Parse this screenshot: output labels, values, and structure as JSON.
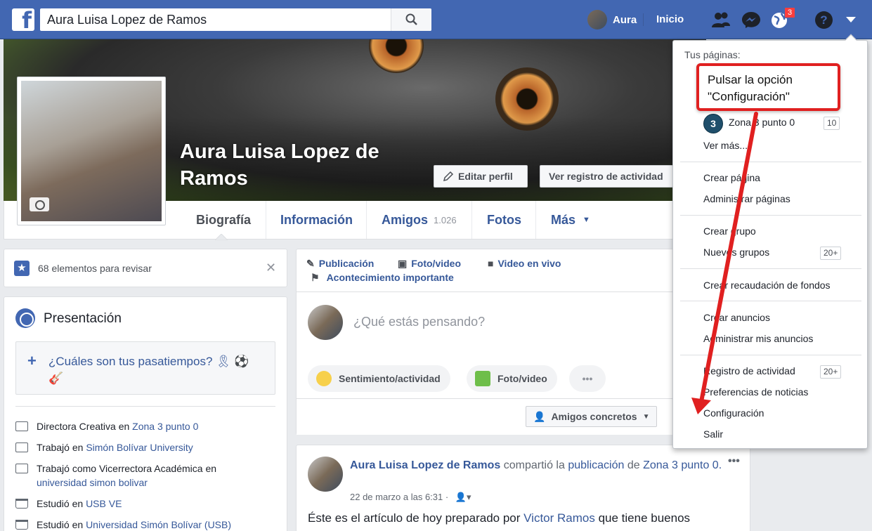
{
  "topbar": {
    "logo": "f",
    "search_value": "Aura Luisa Lopez de Ramos",
    "user_name": "Aura",
    "home": "Inicio",
    "notifications_badge": "3",
    "help": "?",
    "brand_color": "#4267b2"
  },
  "profile": {
    "name": "Aura Luisa Lopez de Ramos",
    "edit_profile": "Editar perfil",
    "activity_log": "Ver registro de actividad"
  },
  "tabs": {
    "biography": "Biografía",
    "info": "Información",
    "friends": "Amigos",
    "friends_count": "1.026",
    "photos": "Fotos",
    "more": "Más"
  },
  "review": {
    "text": "68 elementos para revisar"
  },
  "presentation": {
    "title": "Presentación",
    "hobbies_prompt": "¿Cuáles son tus pasatiempos? 🎗 ⚽ 🎸",
    "items": [
      {
        "prefix": "Directora Creativa en ",
        "link": "Zona 3 punto 0"
      },
      {
        "prefix": "Trabajó en ",
        "link": "Simón Bolívar University"
      },
      {
        "prefix": "Trabajó como Vicerrectora Académica en ",
        "link": "universidad simon bolivar"
      },
      {
        "prefix": "Estudió en ",
        "link": "USB VE"
      },
      {
        "prefix": "Estudió en ",
        "link": "Universidad Simón Bolívar (USB)"
      }
    ]
  },
  "composer": {
    "post": "Publicación",
    "photo_video": "Foto/video",
    "live": "Video en vivo",
    "life_event": "Acontecimiento importante",
    "placeholder": "¿Qué estás pensando?",
    "feeling": "Sentimiento/actividad",
    "photo_video_pill": "Foto/video",
    "more": "•••",
    "audience": "Amigos concretos"
  },
  "post": {
    "author": "Aura Luisa Lopez de Ramos",
    "shared": " compartió la ",
    "publication": "publicación",
    "of": " de ",
    "page": "Zona 3 punto 0",
    "period": ".",
    "date": "22 de marzo a las 6:31 ·",
    "text_prefix": "Éste es el artículo de hoy preparado por ",
    "text_link": "Victor Ramos",
    "text_suffix": " que tiene buenos",
    "menu": "•••"
  },
  "dropdown": {
    "your_pages": "Tus páginas:",
    "page_name": "Zona 3 punto 0",
    "page_avatar": "3",
    "page_count": "10",
    "see_more": "Ver más...",
    "create_page": "Crear página",
    "manage_pages": "Administrar páginas",
    "create_group": "Crear grupo",
    "new_groups": "Nuevos grupos",
    "new_groups_count": "20+",
    "fundraiser": "Crear recaudación de fondos",
    "create_ads": "Crear anuncios",
    "manage_ads": "Administrar mis anuncios",
    "activity_log": "Registro de actividad",
    "activity_count": "20+",
    "news_prefs": "Preferencias de noticias",
    "settings": "Configuración",
    "logout": "Salir"
  },
  "callout": {
    "text": "Pulsar la opción \"Configuración\""
  },
  "colors": {
    "accent": "#4267b2",
    "link": "#365899",
    "callout": "#e02020"
  }
}
